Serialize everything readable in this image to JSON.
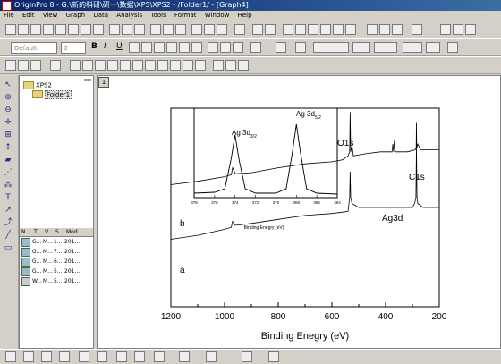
{
  "window": {
    "title": "OriginPro 8 - G:\\新的科研\\研一\\数据\\XPS\\XPS2 - /Folder1/ - [Graph4]"
  },
  "menu": [
    "File",
    "Edit",
    "View",
    "Graph",
    "Data",
    "Analysis",
    "Tools",
    "Format",
    "Window",
    "Help"
  ],
  "format_toolbar": {
    "font": "Default",
    "size": "0"
  },
  "project_explorer": {
    "root": "XPS2",
    "folder": "Folder1",
    "columns": [
      "N.",
      "T.",
      "V.",
      "S.",
      "Mod."
    ],
    "rows": [
      {
        "n": "G...",
        "t": "M...",
        "v": "1...",
        "s": "201..."
      },
      {
        "n": "G...",
        "t": "M...",
        "v": "7...",
        "s": "201..."
      },
      {
        "n": "G...",
        "t": "M...",
        "v": "6...",
        "s": "201..."
      },
      {
        "n": "G...",
        "t": "M...",
        "v": "5...",
        "s": "201..."
      },
      {
        "n": "W...",
        "t": "M...",
        "v": "5...",
        "s": "201..."
      }
    ]
  },
  "graph": {
    "layer_tab": "1"
  },
  "chart_data": [
    {
      "type": "line",
      "xlabel": "Binding Enegry (eV)",
      "ylabel": "",
      "xlim": [
        1200,
        200
      ],
      "x_reversed": true,
      "xticks": [
        "1200",
        "1000",
        "800",
        "600",
        "400",
        "200"
      ],
      "series": [
        {
          "name": "b",
          "points": [
            [
              1200,
              0.615
            ],
            [
              1100,
              0.632
            ],
            [
              1000,
              0.655
            ],
            [
              975,
              0.665
            ],
            [
              970,
              0.7
            ],
            [
              960,
              0.67
            ],
            [
              900,
              0.675
            ],
            [
              800,
              0.7
            ],
            [
              700,
              0.72
            ],
            [
              600,
              0.73
            ],
            [
              560,
              0.74
            ],
            [
              540,
              0.76
            ],
            [
              534,
              0.78
            ],
            [
              532,
              0.98
            ],
            [
              530,
              0.78
            ],
            [
              525,
              0.81
            ],
            [
              520,
              0.76
            ],
            [
              480,
              0.77
            ],
            [
              420,
              0.78
            ],
            [
              376,
              0.78
            ],
            [
              373,
              0.82
            ],
            [
              370,
              0.78
            ],
            [
              367,
              0.84
            ],
            [
              364,
              0.78
            ],
            [
              320,
              0.78
            ],
            [
              290,
              0.79
            ],
            [
              286,
              0.8
            ],
            [
              285,
              0.93
            ],
            [
              284,
              0.8
            ],
            [
              280,
              0.82
            ],
            [
              270,
              0.79
            ],
            [
              200,
              0.79
            ]
          ]
        },
        {
          "name": "a",
          "points": [
            [
              1200,
              0.34
            ],
            [
              1100,
              0.36
            ],
            [
              1000,
              0.39
            ],
            [
              975,
              0.4
            ],
            [
              970,
              0.43
            ],
            [
              960,
              0.41
            ],
            [
              900,
              0.42
            ],
            [
              800,
              0.44
            ],
            [
              700,
              0.46
            ],
            [
              600,
              0.47
            ],
            [
              540,
              0.48
            ],
            [
              534,
              0.55
            ],
            [
              532,
              0.68
            ],
            [
              530,
              0.55
            ],
            [
              525,
              0.52
            ],
            [
              500,
              0.5
            ],
            [
              400,
              0.5
            ],
            [
              300,
              0.5
            ],
            [
              292,
              0.52
            ],
            [
              287,
              0.55
            ],
            [
              285,
              0.81
            ],
            [
              283,
              0.55
            ],
            [
              280,
              0.52
            ],
            [
              260,
              0.5
            ],
            [
              200,
              0.5
            ]
          ]
        }
      ],
      "annotations": [
        "O1s",
        "Ag3d",
        "C1s"
      ]
    },
    {
      "type": "line",
      "xlabel": "Binding Enegry (eV)",
      "xlim": [
        378,
        364
      ],
      "x_reversed": true,
      "xticks": [
        "378",
        "376",
        "374",
        "372",
        "370",
        "368",
        "366",
        "364"
      ],
      "series": [
        {
          "name": "Ag 3d",
          "points": [
            [
              378,
              0.05
            ],
            [
              376,
              0.06
            ],
            [
              375,
              0.1
            ],
            [
              374.4,
              0.42
            ],
            [
              374,
              0.7
            ],
            [
              373.6,
              0.42
            ],
            [
              373,
              0.1
            ],
            [
              372,
              0.05
            ],
            [
              370,
              0.05
            ],
            [
              369,
              0.1
            ],
            [
              368.4,
              0.5
            ],
            [
              368,
              0.82
            ],
            [
              367.6,
              0.5
            ],
            [
              367,
              0.1
            ],
            [
              366,
              0.05
            ],
            [
              364,
              0.04
            ]
          ]
        }
      ],
      "peak_labels": [
        {
          "text": "Ag 3d",
          "sub": "3/2"
        },
        {
          "text": "Ag 3d",
          "sub": "5/2"
        }
      ]
    }
  ]
}
